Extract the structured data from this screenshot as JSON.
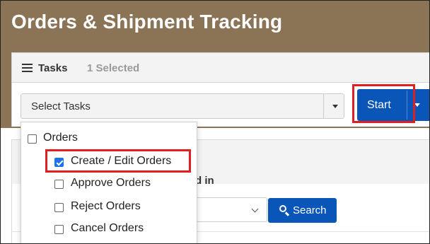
{
  "app": {
    "title": "Orders & Shipment Tracking"
  },
  "tasks": {
    "label": "Tasks",
    "selected_count": "1 Selected"
  },
  "select": {
    "label": "Select Tasks"
  },
  "start": {
    "label": "Start"
  },
  "dropdown": {
    "group": {
      "label": "Orders",
      "checked": false
    },
    "items": [
      {
        "label": "Create / Edit Orders",
        "checked": true
      },
      {
        "label": "Approve Orders",
        "checked": false
      },
      {
        "label": "Reject Orders",
        "checked": false
      },
      {
        "label": "Cancel Orders",
        "checked": false
      }
    ]
  },
  "background_panel": {
    "partial_text": "d in"
  },
  "search": {
    "label": "Search"
  },
  "colors": {
    "header_bg": "#8b7456",
    "primary": "#0a56b8",
    "highlight": "#e02020",
    "checkbox_checked": "#1a73e8"
  },
  "icons": {
    "tasks": "list-icon",
    "search": "search-icon",
    "select_caret": "caret-down-icon",
    "start_caret": "caret-down-icon",
    "filter_caret": "chevron-down-icon"
  }
}
